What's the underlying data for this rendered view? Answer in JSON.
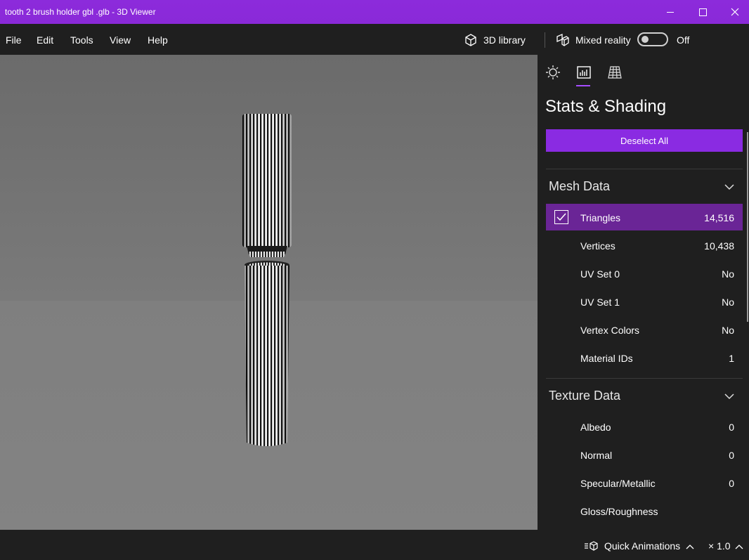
{
  "window": {
    "title": "tooth 2 brush holder gbl .glb - 3D Viewer"
  },
  "menu": {
    "file": "File",
    "edit": "Edit",
    "tools": "Tools",
    "view": "View",
    "help": "Help"
  },
  "toolbar": {
    "library_label": "3D library",
    "mixed_reality_label": "Mixed reality",
    "toggle_state": "Off"
  },
  "panel": {
    "title": "Stats & Shading",
    "deselect_label": "Deselect All",
    "mesh_section": "Mesh Data",
    "mesh_rows": [
      {
        "label": "Triangles",
        "value": "14,516"
      },
      {
        "label": "Vertices",
        "value": "10,438"
      },
      {
        "label": "UV Set 0",
        "value": "No"
      },
      {
        "label": "UV Set 1",
        "value": "No"
      },
      {
        "label": "Vertex Colors",
        "value": "No"
      },
      {
        "label": "Material IDs",
        "value": "1"
      }
    ],
    "texture_section": "Texture Data",
    "texture_rows": [
      {
        "label": "Albedo",
        "value": "0"
      },
      {
        "label": "Normal",
        "value": "0"
      },
      {
        "label": "Specular/Metallic",
        "value": "0"
      },
      {
        "label": "Gloss/Roughness",
        "value": ""
      }
    ]
  },
  "bottom": {
    "quick_animations": "Quick Animations",
    "speed": "× 1.0"
  },
  "colors": {
    "accent": "#8a2be2",
    "selected_row": "#6a2596",
    "background": "#1f1f1f"
  }
}
